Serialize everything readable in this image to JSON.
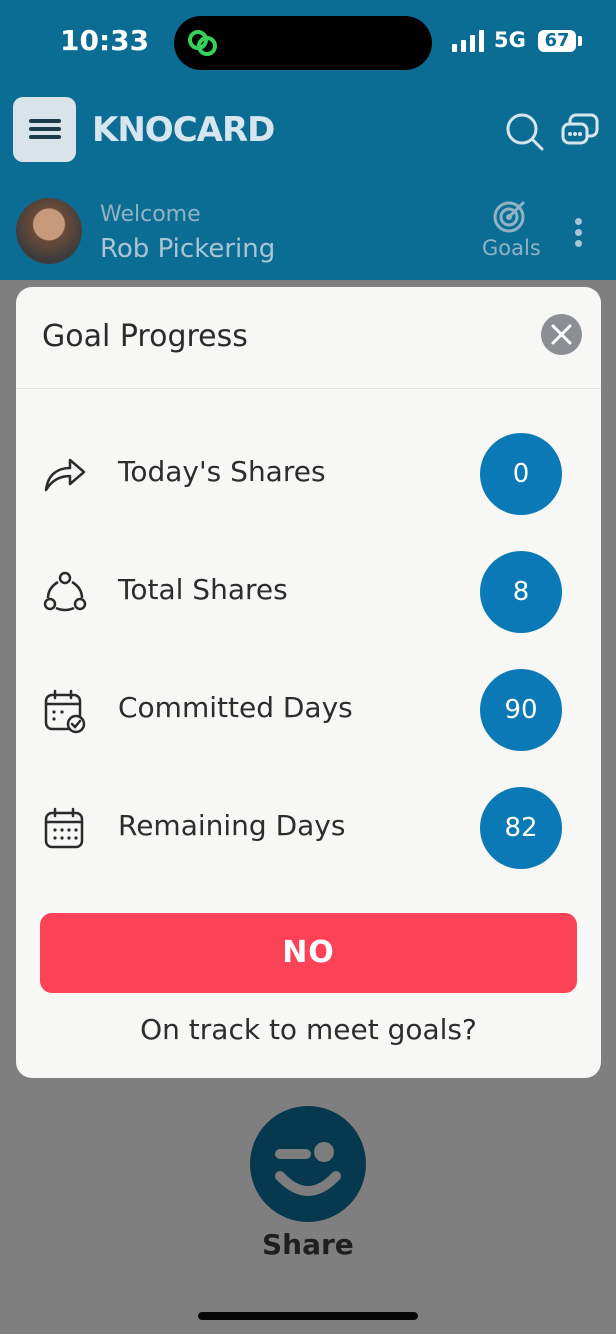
{
  "status_bar": {
    "time": "10:33",
    "network": "5G",
    "battery": "67"
  },
  "header": {
    "logo_text": "KNOCARD",
    "welcome": "Welcome",
    "user_name": "Rob Pickering",
    "goals_label": "Goals"
  },
  "modal": {
    "title": "Goal Progress",
    "stats": [
      {
        "label": "Today's Shares",
        "value": "0",
        "icon": "share-arrow-icon"
      },
      {
        "label": "Total Shares",
        "value": "8",
        "icon": "network-icon"
      },
      {
        "label": "Committed Days",
        "value": "90",
        "icon": "calendar-check-icon"
      },
      {
        "label": "Remaining Days",
        "value": "82",
        "icon": "calendar-icon"
      }
    ],
    "status_button": "NO",
    "status_caption": "On track to meet goals?"
  },
  "footer": {
    "share_label": "Share"
  },
  "colors": {
    "brand_header": "#0c6d94",
    "badge": "#0a79b5",
    "alert": "#fb4257"
  }
}
